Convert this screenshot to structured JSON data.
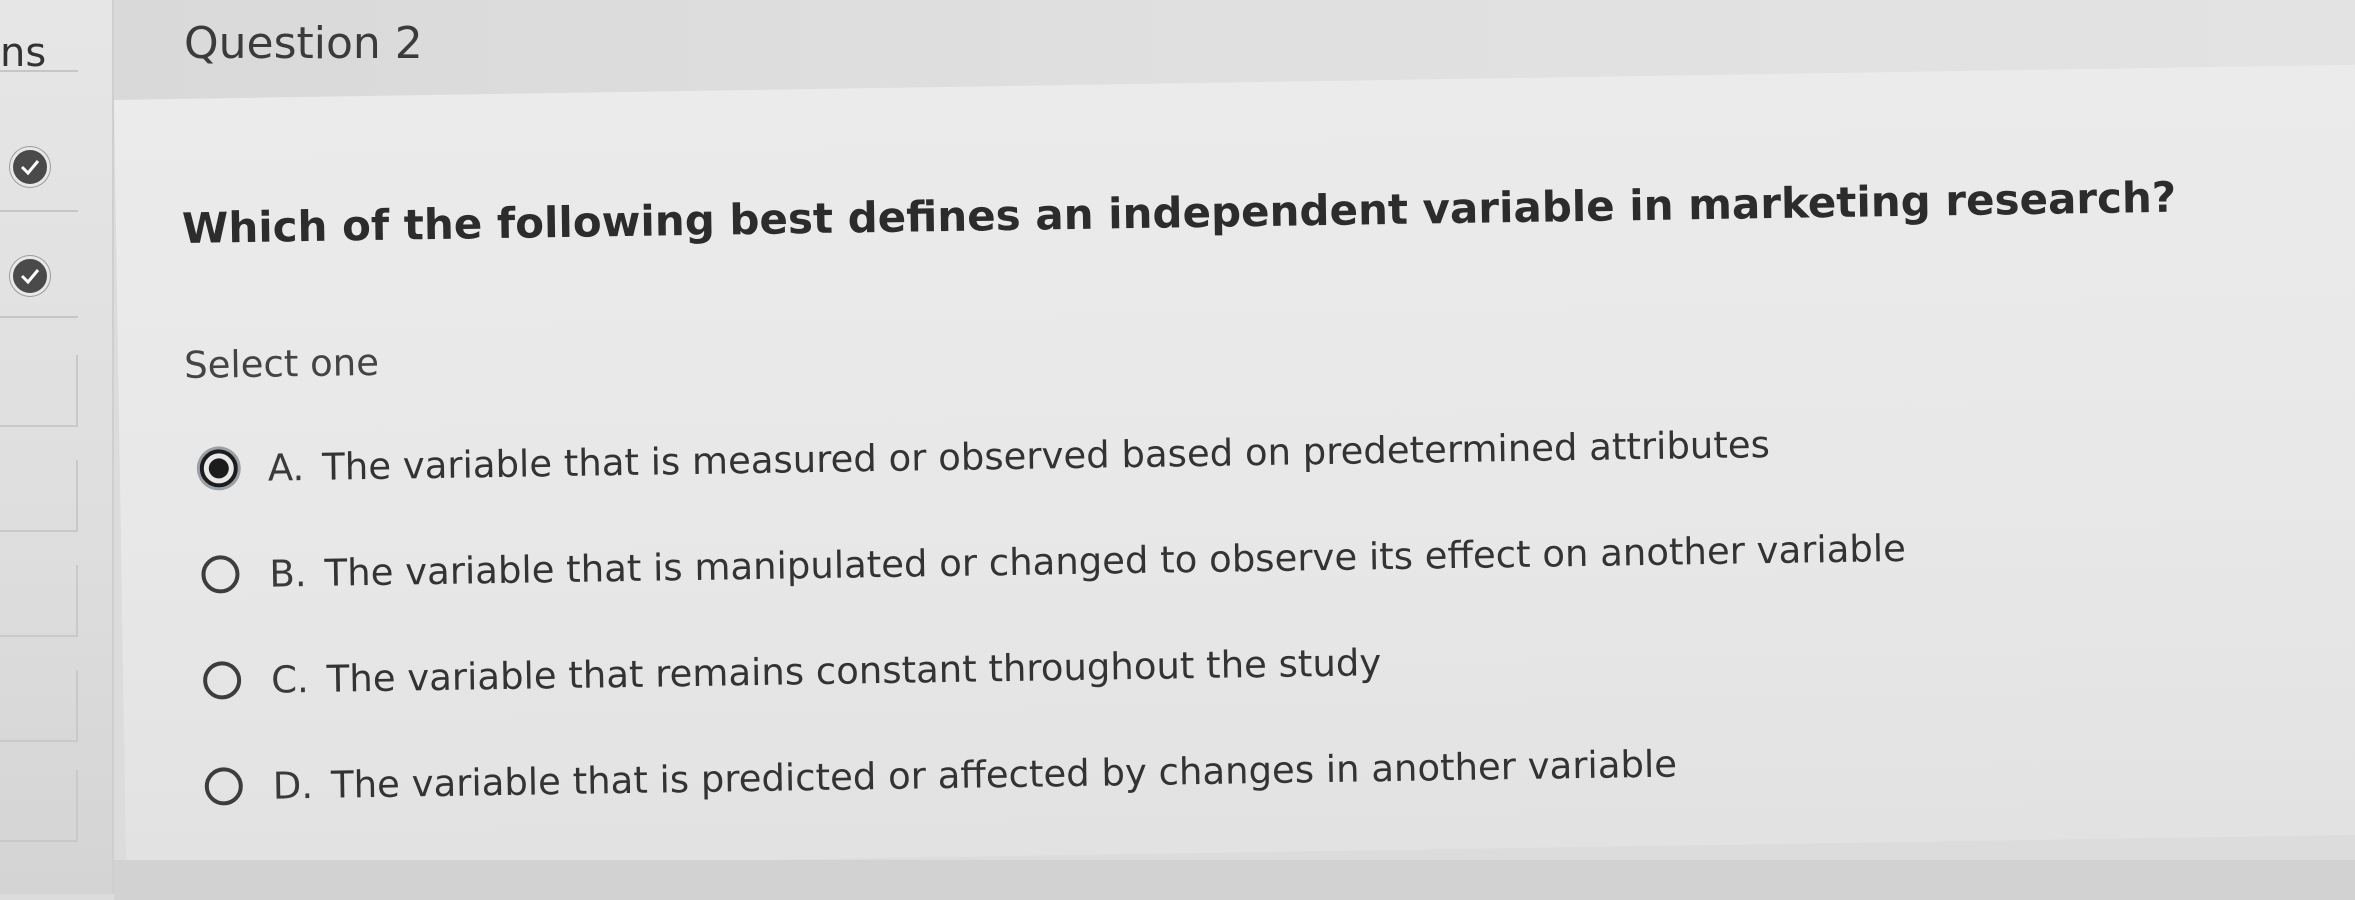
{
  "sidebar": {
    "title": "ns",
    "completed_icons": [
      "check-circle-icon",
      "check-circle-icon"
    ]
  },
  "header": {
    "question_number": "Question 2"
  },
  "question": {
    "text": "Which of the following best defines an independent variable in marketing research?",
    "prompt": "Select one",
    "selected": "A",
    "options": [
      {
        "letter": "A.",
        "text": "The variable that is measured or observed based on predetermined attributes"
      },
      {
        "letter": "B.",
        "text": "The variable that is manipulated or changed to observe its effect on another variable"
      },
      {
        "letter": "C.",
        "text": "The variable that remains constant throughout the study"
      },
      {
        "letter": "D.",
        "text": "The variable that is predicted or affected by changes in another variable"
      }
    ]
  },
  "colors": {
    "background": "#e8e8e8",
    "text": "#333333",
    "selected_radio": "#1c1c1c"
  }
}
